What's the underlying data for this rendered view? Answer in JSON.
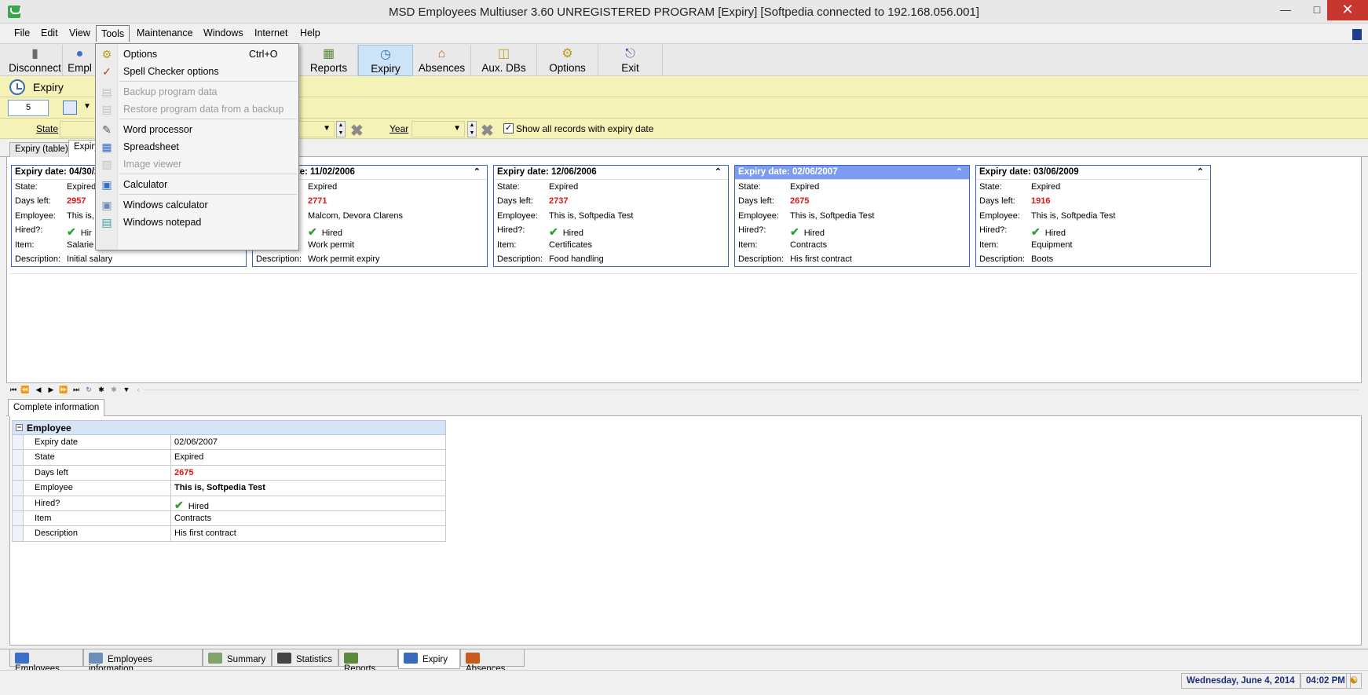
{
  "window": {
    "title": "MSD Employees Multiuser 3.60 UNREGISTERED PROGRAM [Expiry] [Softpedia connected to 192.168.056.001]",
    "minimize": "—",
    "maximize": "□",
    "close": "✕"
  },
  "menubar": {
    "items": [
      "File",
      "Edit",
      "View",
      "Tools",
      "Maintenance",
      "Windows",
      "Internet",
      "Help"
    ],
    "active": "Tools"
  },
  "toolbar": {
    "buttons": [
      "Disconnect",
      "Empl",
      "Reports",
      "Expiry",
      "Absences",
      "Aux. DBs",
      "Options",
      "Exit"
    ]
  },
  "module": {
    "title": "Expiry",
    "record_count": "5"
  },
  "filters": {
    "state_label": "State",
    "state_value": "",
    "year_label": "Year",
    "year_value": "",
    "show_all_checked": true,
    "show_all_label": "Show all records with expiry date"
  },
  "view_tabs": [
    "Expiry (table)",
    "Expiry"
  ],
  "card_labels": {
    "expiry_date": "Expiry date:",
    "state": "State:",
    "days_left": "Days left:",
    "employee": "Employee:",
    "hired": "Hired?:",
    "item": "Item:",
    "description": "Description:"
  },
  "cards": [
    {
      "expiry_date": "04/30/2",
      "state": "Expired",
      "days_left": "2957",
      "employee": "This is,",
      "hired": "Hir",
      "item": "Salarie",
      "description": "Initial salary"
    },
    {
      "expiry_date": "11/02/2006",
      "state": "Expired",
      "days_left": "2771",
      "employee": "Malcom, Devora Clarens",
      "hired": "Hired",
      "item": "Work permit",
      "description": "Work permit expiry"
    },
    {
      "expiry_date": "12/06/2006",
      "state": "Expired",
      "days_left": "2737",
      "employee": "This is, Softpedia Test",
      "hired": "Hired",
      "item": "Certificates",
      "description": "Food handling"
    },
    {
      "expiry_date": "02/06/2007",
      "state": "Expired",
      "days_left": "2675",
      "employee": "This is, Softpedia Test",
      "hired": "Hired",
      "item": "Contracts",
      "description": "His first contract"
    },
    {
      "expiry_date": "03/06/2009",
      "state": "Expired",
      "days_left": "1916",
      "employee": "This is, Softpedia Test",
      "hired": "Hired",
      "item": "Equipment",
      "description": "Boots"
    }
  ],
  "selected_card_index": 3,
  "detail": {
    "tab": "Complete information",
    "group": "Employee",
    "rows": [
      {
        "key": "Expiry date",
        "value": "02/06/2007"
      },
      {
        "key": "State",
        "value": "Expired"
      },
      {
        "key": "Days left",
        "value": "2675"
      },
      {
        "key": "Employee",
        "value": "This is, Softpedia Test"
      },
      {
        "key": "Hired?",
        "value": "Hired"
      },
      {
        "key": "Item",
        "value": "Contracts"
      },
      {
        "key": "Description",
        "value": "His first contract"
      }
    ]
  },
  "module_tabs": [
    "Employees",
    "Employees information",
    "Summary",
    "Statistics",
    "Reports",
    "Expiry",
    "Absences"
  ],
  "active_module_tab": "Expiry",
  "status": {
    "date": "Wednesday, June 4, 2014",
    "time": "04:02 PM"
  },
  "tools_menu": {
    "items": [
      {
        "label": "Options",
        "shortcut": "Ctrl+O",
        "enabled": true,
        "icon": "gears-icon"
      },
      {
        "label": "Spell Checker options",
        "shortcut": "",
        "enabled": true,
        "icon": "spell-check-icon"
      },
      {
        "label": "Backup program data",
        "shortcut": "",
        "enabled": false,
        "icon": "backup-icon"
      },
      {
        "label": "Restore program data from a backup",
        "shortcut": "",
        "enabled": false,
        "icon": "restore-icon"
      },
      {
        "label": "Word processor",
        "shortcut": "",
        "enabled": true,
        "icon": "word-processor-icon"
      },
      {
        "label": "Spreadsheet",
        "shortcut": "",
        "enabled": true,
        "icon": "spreadsheet-icon"
      },
      {
        "label": "Image viewer",
        "shortcut": "",
        "enabled": false,
        "icon": "image-viewer-icon"
      },
      {
        "label": "Calculator",
        "shortcut": "",
        "enabled": true,
        "icon": "calculator-icon"
      },
      {
        "label": "Windows calculator",
        "shortcut": "",
        "enabled": true,
        "icon": "windows-calculator-icon"
      },
      {
        "label": "Windows notepad",
        "shortcut": "",
        "enabled": true,
        "icon": "notepad-icon"
      }
    ]
  },
  "colors": {
    "accent_yellow": "#f5f2b8",
    "card_border": "#3b64c4",
    "selected_card": "#7c9cf0",
    "days_left_red": "#e21313",
    "hired_check": "#2fa12f",
    "close_red": "#c7372f"
  }
}
